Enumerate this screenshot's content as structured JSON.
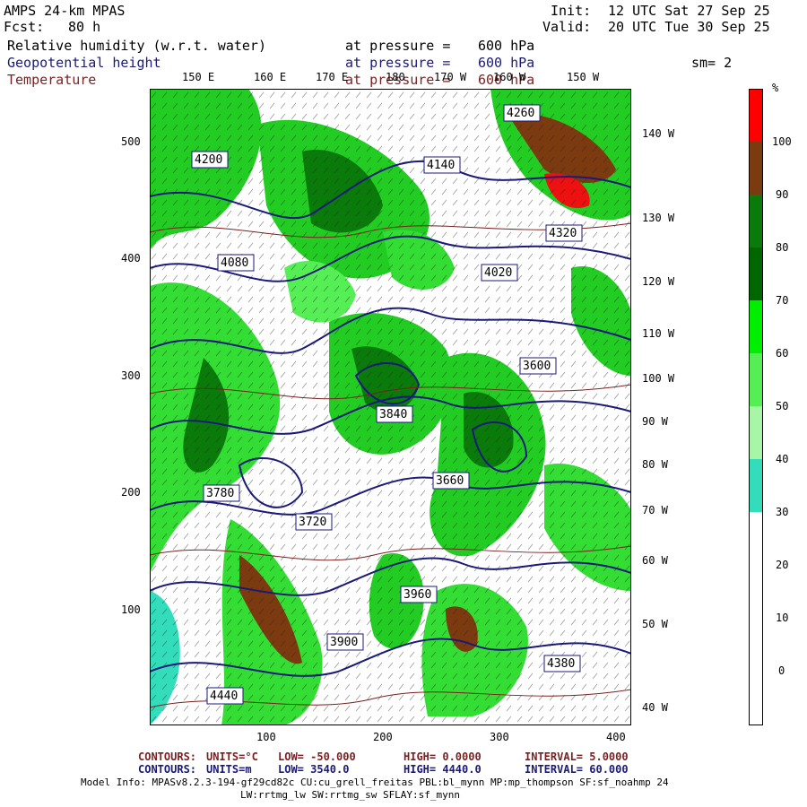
{
  "header": {
    "model": "AMPS 24-km MPAS",
    "fcst_label": "Fcst:",
    "fcst_value": "80 h",
    "init_label": "Init:",
    "init_value": "12 UTC Sat 27 Sep 25",
    "valid_label": "Valid:",
    "valid_value": "20 UTC Tue 30 Sep 25"
  },
  "fields": [
    {
      "name": "Relative humidity (w.r.t. water)",
      "level_label": "at pressure =",
      "level_value": "600 hPa",
      "color": "#000000"
    },
    {
      "name": "Geopotential height",
      "level_label": "at pressure =",
      "level_value": "600 hPa",
      "color": "#1a1a7a"
    },
    {
      "name": "Temperature",
      "level_label": "at pressure =",
      "level_value": "600 hPa",
      "color": "#7a1f1f"
    }
  ],
  "smoothing": "sm= 2",
  "map": {
    "lon_top_labels": [
      "150 E",
      "160 E",
      "170 E",
      "180",
      "170 W",
      "160 W",
      "150 W"
    ],
    "lon_right_labels": [
      "140 W",
      "130 W",
      "120 W",
      "110 W",
      "100 W",
      "90 W",
      "80 W",
      "70 W",
      "60 W",
      "50 W",
      "40 W"
    ],
    "y_axis_ticks": [
      "500",
      "400",
      "300",
      "200",
      "100"
    ],
    "x_axis_ticks": [
      "100",
      "200",
      "300",
      "400"
    ],
    "height_labels": [
      "4260",
      "4200",
      "4080",
      "3960",
      "3900",
      "3840",
      "3780",
      "3720",
      "3660",
      "3600",
      "4140",
      "4020",
      "4320",
      "4440",
      "4380"
    ]
  },
  "colorbar": {
    "unit": "%",
    "labels": [
      "100",
      "90",
      "80",
      "70",
      "60",
      "50",
      "40",
      "30",
      "20",
      "10",
      "0"
    ],
    "colors": [
      "#ff0000",
      "#7b3a10",
      "#0a7a0a",
      "#006600",
      "#00ee00",
      "#55ee55",
      "#a8f5a8",
      "#33ddbb",
      "#ffffff",
      "#ffffff",
      "#ffffff"
    ]
  },
  "footer": {
    "temp_contours": {
      "label": "CONTOURS:",
      "units": "UNITS=°C",
      "low": "LOW= -50.000",
      "high": "HIGH= 0.0000",
      "interval": "INTERVAL= 5.0000"
    },
    "height_contours": {
      "label": "CONTOURS:",
      "units": "UNITS=m",
      "low": "LOW= 3540.0",
      "high": "HIGH= 4440.0",
      "interval": "INTERVAL= 60.000"
    },
    "model_info_1": "Model Info: MPASv8.2.3-194-gf29cd82c CU:cu_grell_freitas PBL:bl_mynn MP:mp_thompson SF:sf_noahmp 24",
    "model_info_2": "LW:rrtmg_lw SW:rrtmg_sw SFLAY:sf_mynn"
  }
}
